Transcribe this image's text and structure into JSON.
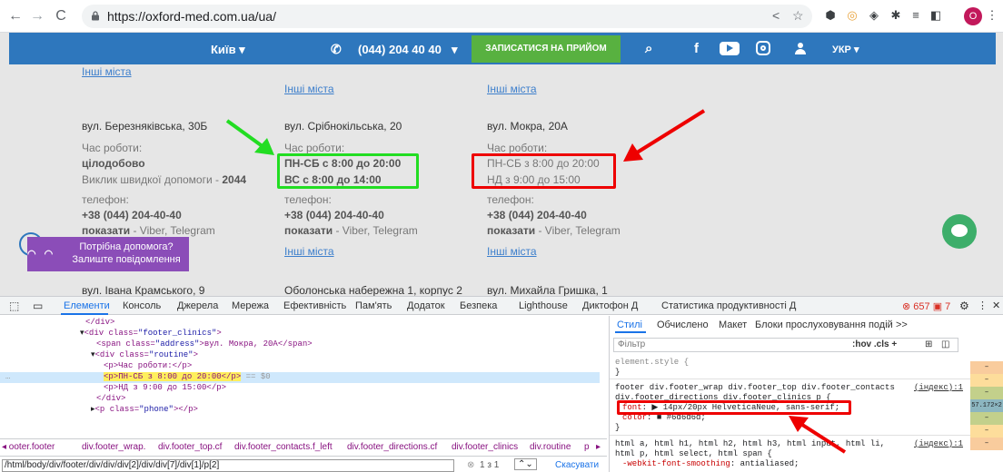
{
  "browser": {
    "url": "https://oxford-med.com.ua/ua/",
    "profile_initial": "O"
  },
  "site": {
    "header": {
      "city": "Київ ▾",
      "phone": "(044) 204 40 40",
      "phone_caret": "▾",
      "book_button": "ЗАПИСАТИСЯ НА ПРИЙОМ",
      "facebook": "f",
      "language": "УКР ▾"
    },
    "columns": [
      {
        "other_cities_top": "Інші міста",
        "address": "вул. Березняківська, 30Б",
        "hours_label": "Час роботи:",
        "hours_1": "цілодобово",
        "hours_2_prefix": "Виклик швидкої допомоги - ",
        "hours_2_bold": "2044",
        "phone_label": "телефон:",
        "phone": "+38 (044) 204-40-40",
        "show": "показати",
        "show_rest": " - Viber, Telegram",
        "next_address": "вул. Івана Крамського, 9"
      },
      {
        "other_cities_top": "Інші міста",
        "address": "вул. Срібнокільська, 20",
        "hours_label": "Час роботи:",
        "hours_1": "ПН-СБ с 8:00 до 20:00",
        "hours_2": "ВС с 8:00 до 14:00",
        "phone_label": "телефон:",
        "phone": "+38 (044) 204-40-40",
        "show": "показати",
        "show_rest": " - Viber, Telegram",
        "other_cities": "Інші міста",
        "next_address": "Оболонська набережна 1, корпус 2"
      },
      {
        "other_cities_top": "Інші міста",
        "address": "вул. Мокра, 20А",
        "hours_label": "Час роботи:",
        "hours_1": "ПН-СБ з 8:00 до 20:00",
        "hours_2": "НД з 9:00 до 15:00",
        "phone_label": "телефон:",
        "phone": "+38 (044) 204-40-40",
        "show": "показати",
        "show_rest": " - Viber, Telegram",
        "other_cities": "Інші міста",
        "next_address": "вул. Михайла Гришка, 1"
      }
    ],
    "chat_widget": {
      "logo": "◠ ◠",
      "line1": "Потрібна допомога?",
      "line2": "Залиште повідомлення"
    }
  },
  "devtools": {
    "tabs": [
      "Елементи",
      "Консоль",
      "Джерела",
      "Мережа",
      "Ефективність",
      "Пам'ять",
      "Додаток",
      "Безпека",
      "Lighthouse",
      "Диктофон Д",
      "Статистика продуктивності Д"
    ],
    "errors": "⊗ 657",
    "warnings": "▣ 7",
    "code": {
      "l1": "</div>",
      "l2_tag": "<div class=",
      "l2_val": "\"footer_clinics\"",
      "l2_end": ">",
      "l3_tag": "<span class=",
      "l3_val": "\"address\"",
      "l3_text": ">вул. Мокра, 20А</span>",
      "l4_tag": "<div class=",
      "l4_val": "\"routine\"",
      "l4_end": ">",
      "l5": "<p>Час роботи:</p>",
      "l6": "<p>ПН-СБ з 8:00 до 20:00</p>",
      "l6_eq": " == $0",
      "l7": "<p>НД з 9:00 до 15:00</p>",
      "l8": "</div>",
      "l9_tag": "<p class=",
      "l9_val": "\"phone\"",
      "l9_end": "></p>"
    },
    "breadcrumbs": [
      "◂ ooter.footer",
      "div.footer_wrap.",
      "div.footer_top.cf",
      "div.footer_contacts.f_left",
      "div.footer_directions.cf",
      "div.footer_clinics",
      "div.routine",
      "p",
      "▸"
    ],
    "xpath": "/html/body/div/footer/div/div/div[2]/div/div[7]/div[1]/p[2]",
    "search_count": "1 з 1",
    "cancel": "Скасувати",
    "styles": {
      "tabs": [
        "Стилі",
        "Обчислено",
        "Макет",
        "Блоки прослуховування подій",
        ">>"
      ],
      "filter_placeholder": "Фільтр",
      "filter_tools": ":hov  .cls  +",
      "l1": "element.style {",
      "l2": "}",
      "l3": "footer div.footer_wrap div.footer_top div.footer_contacts",
      "l4": "div.footer_directions div.footer_clinics p {",
      "link1": "(індекс):1",
      "font_prop": "font",
      "font_val": ": ▶ 14px/20px HelveticaNeue, sans-serif;",
      "color_prop": "color",
      "color_val": ": ■ #6d6d6d;",
      "l7": "}",
      "l8": "html a, html h1, html h2, html h3, html input, html li,",
      "l9": "html p, html select, html span {",
      "link2": "(індекс):1",
      "l10_prop": "-webkit-font-smoothing",
      "l10_val": ": antialiased;"
    },
    "mini": [
      "–",
      "–",
      "–",
      "57.172×2",
      "–",
      "–",
      "–"
    ]
  },
  "colors": {
    "site_blue": "#2e77bd",
    "green_button": "#58b140",
    "highlight_green": "#22dd22",
    "highlight_red": "#ee0000",
    "chat_purple": "#8b4db8"
  }
}
